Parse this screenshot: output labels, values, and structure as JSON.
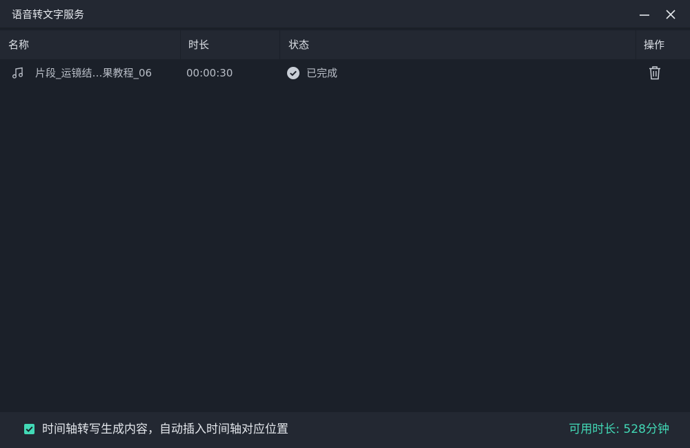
{
  "window": {
    "title": "语音转文字服务",
    "minimize_icon": "minimize-icon",
    "close_icon": "close-icon"
  },
  "table": {
    "columns": {
      "name": "名称",
      "duration": "时长",
      "status": "状态",
      "action": "操作"
    },
    "rows": [
      {
        "icon": "music-note-icon",
        "name": "片段_运镜结…果教程_06",
        "duration": "00:00:30",
        "status_icon": "check-circle-icon",
        "status": "已完成",
        "action_icon": "trash-icon"
      }
    ]
  },
  "footer": {
    "checkbox_checked": true,
    "checkbox_label": "时间轴转写生成内容，自动插入时间轴对应位置",
    "available_time": "可用时长: 528分钟"
  },
  "colors": {
    "accent": "#42d9b6",
    "background": "#1b2029",
    "panel": "#232832"
  }
}
